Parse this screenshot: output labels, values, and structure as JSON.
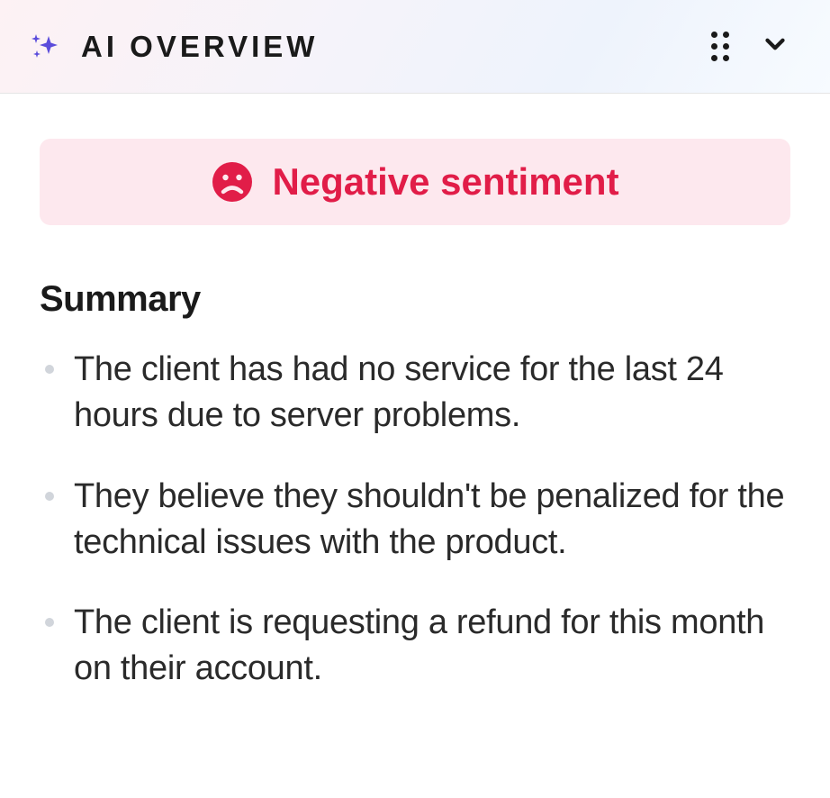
{
  "header": {
    "title": "AI OVERVIEW"
  },
  "sentiment": {
    "label": "Negative sentiment",
    "mood": "negative",
    "color": "#e11d48",
    "bgColor": "#fde8ee"
  },
  "summary": {
    "title": "Summary",
    "items": [
      "The client has had no service for the last 24 hours due to server problems.",
      "They believe they shouldn't be penalized for the technical issues with the product.",
      "The client is requesting a refund for this month on their account."
    ]
  }
}
